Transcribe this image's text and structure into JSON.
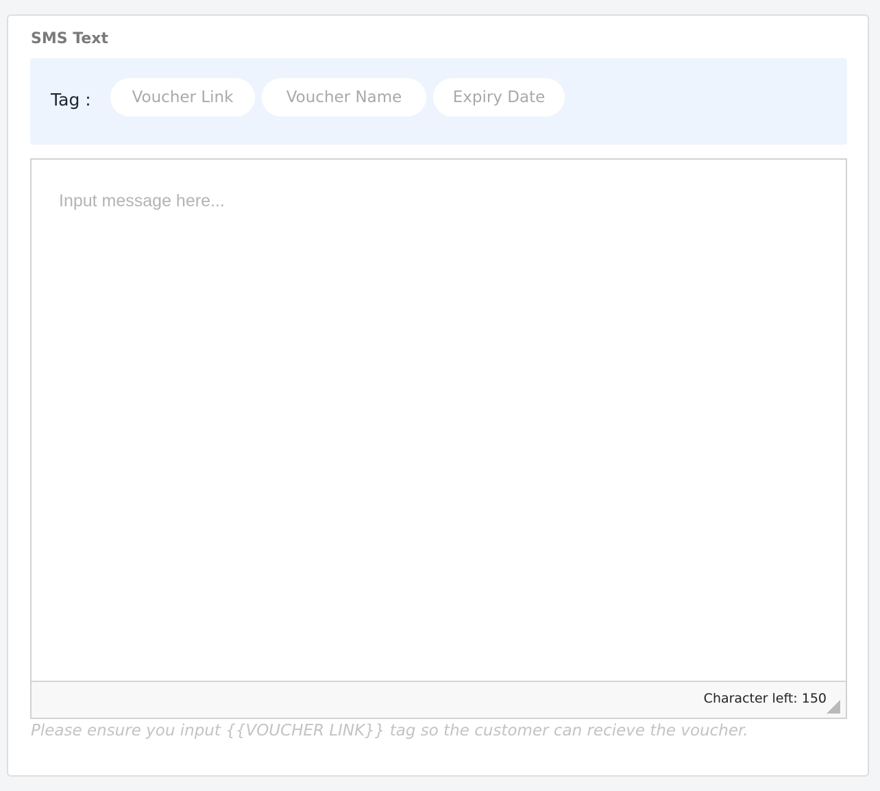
{
  "section": {
    "title": "SMS Text"
  },
  "tags": {
    "label": "Tag :",
    "items": [
      {
        "label": "Voucher Link"
      },
      {
        "label": "Voucher Name"
      },
      {
        "label": "Expiry Date"
      }
    ]
  },
  "editor": {
    "placeholder": "Input message here...",
    "value": "",
    "char_left_text": "Character left: 150"
  },
  "hint": {
    "text": "Please ensure you input {{VOUCHER LINK}} tag so the customer can recieve the voucher."
  },
  "colors": {
    "tag_bar_bg": "#edf4fd",
    "chip_text": "#a9a9a9",
    "title_text": "#7a7a7a",
    "hint_text": "#c3c3c3"
  }
}
